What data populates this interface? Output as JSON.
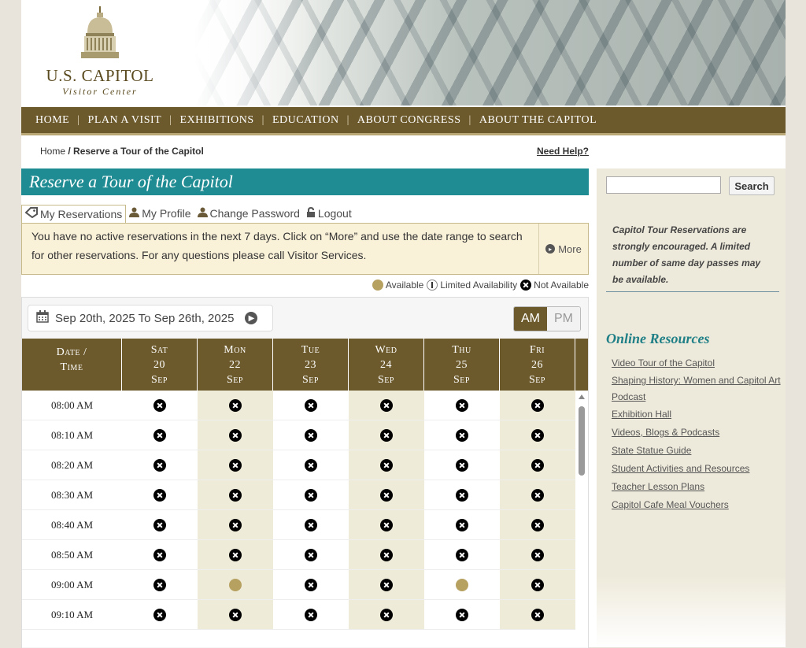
{
  "logo": {
    "line1": "U.S. CAPITOL",
    "line2": "Visitor Center"
  },
  "nav": {
    "items": [
      "HOME",
      "PLAN A VISIT",
      "EXHIBITIONS",
      "EDUCATION",
      "ABOUT CONGRESS",
      "ABOUT THE CAPITOL"
    ]
  },
  "breadcrumb": {
    "home": "Home",
    "sep": " / ",
    "current": "Reserve a Tour of the Capitol"
  },
  "help_link": "Need Help?",
  "page_title": "Reserve a Tour of the Capitol",
  "tabs": [
    {
      "label": "My Reservations",
      "icon": "tag-icon",
      "active": true
    },
    {
      "label": "My Profile",
      "icon": "user-icon",
      "active": false
    },
    {
      "label": "Change Password",
      "icon": "user-icon",
      "active": false
    },
    {
      "label": "Logout",
      "icon": "lock-icon",
      "active": false
    }
  ],
  "notice": {
    "text": "You have no active reservations in the next 7 days. Click on “More” and use the date range to search for other reservations. For any questions please call Visitor Services.",
    "more_label": "More"
  },
  "legend": {
    "available": "Available",
    "limited": "Limited Availability",
    "not_available": "Not Available"
  },
  "calendar": {
    "date_range": "Sep 20th, 2025 To Sep 26th, 2025",
    "am_label": "AM",
    "pm_label": "PM",
    "selected_period": "AM",
    "time_header": [
      "Date /",
      "Time"
    ],
    "days": [
      {
        "dow": "Sat",
        "day": "20",
        "mon": "Sep"
      },
      {
        "dow": "Mon",
        "day": "22",
        "mon": "Sep"
      },
      {
        "dow": "Tue",
        "day": "23",
        "mon": "Sep"
      },
      {
        "dow": "Wed",
        "day": "24",
        "mon": "Sep"
      },
      {
        "dow": "Thu",
        "day": "25",
        "mon": "Sep"
      },
      {
        "dow": "Fri",
        "day": "26",
        "mon": "Sep"
      }
    ],
    "rows": [
      {
        "time": "08:00 AM",
        "status": [
          "na",
          "na",
          "na",
          "na",
          "na",
          "na"
        ]
      },
      {
        "time": "08:10 AM",
        "status": [
          "na",
          "na",
          "na",
          "na",
          "na",
          "na"
        ]
      },
      {
        "time": "08:20 AM",
        "status": [
          "na",
          "na",
          "na",
          "na",
          "na",
          "na"
        ]
      },
      {
        "time": "08:30 AM",
        "status": [
          "na",
          "na",
          "na",
          "na",
          "na",
          "na"
        ]
      },
      {
        "time": "08:40 AM",
        "status": [
          "na",
          "na",
          "na",
          "na",
          "na",
          "na"
        ]
      },
      {
        "time": "08:50 AM",
        "status": [
          "na",
          "na",
          "na",
          "na",
          "na",
          "na"
        ]
      },
      {
        "time": "09:00 AM",
        "status": [
          "na",
          "available",
          "na",
          "na",
          "available",
          "na"
        ]
      },
      {
        "time": "09:10 AM",
        "status": [
          "na",
          "na",
          "na",
          "na",
          "na",
          "na"
        ]
      }
    ]
  },
  "sidebar": {
    "search_placeholder": "",
    "search_button": "Search",
    "promo": "Capitol Tour Reservations are strongly encouraged. A limited number of same day passes may be available.",
    "resources_title": "Online Resources",
    "resources": [
      "Video Tour of the Capitol",
      "Shaping History: Women and Capitol Art Podcast",
      "Exhibition Hall",
      "Videos, Blogs & Podcasts",
      "State Statue Guide",
      "Student Activities and Resources",
      "Teacher Lesson Plans",
      "Capitol Cafe Meal Vouchers"
    ]
  },
  "colors": {
    "nav_bg": "#6d5a2c",
    "title_bg": "#1f8b92",
    "available": "#b6a161",
    "sidebar_bg": "#eeeadb",
    "accent_link": "#1f7f86"
  }
}
